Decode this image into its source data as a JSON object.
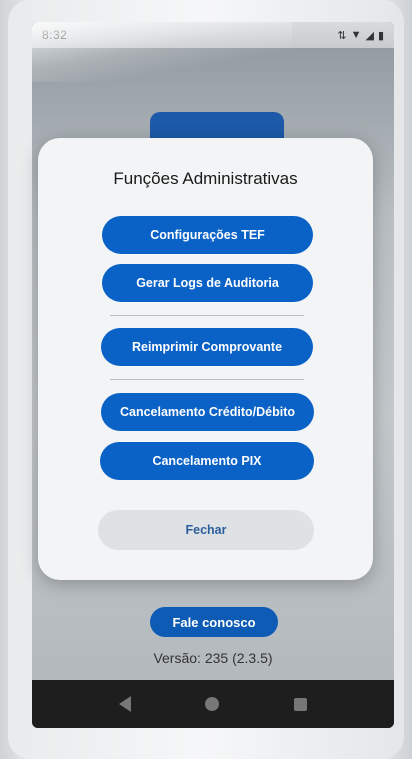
{
  "statusbar": {
    "time": "8:32"
  },
  "dialog": {
    "title": "Funções Administrativas",
    "buttons": [
      {
        "label": "Configurações TEF"
      },
      {
        "label": "Gerar Logs de Auditoria"
      },
      {
        "label": "Reimprimir Comprovante"
      },
      {
        "label": "Cancelamento Crédito/Débito"
      },
      {
        "label": "Cancelamento PIX"
      }
    ],
    "close_label": "Fechar"
  },
  "footer": {
    "contact_label": "Fale conosco",
    "version": "Versão: 235 (2.3.5)"
  },
  "colors": {
    "primary": "#0a62c6",
    "dialog_bg": "#f2f4f6",
    "close_text": "#2a5e9c"
  }
}
